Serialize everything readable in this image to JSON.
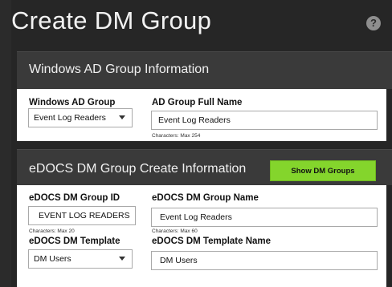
{
  "page": {
    "title": "Create DM Group",
    "help_glyph": "?"
  },
  "ad_section": {
    "heading": "Windows AD Group Information",
    "group_label": "Windows AD Group",
    "group_value": "Event Log Readers",
    "fullname_label": "AD Group Full Name",
    "fullname_value": "Event Log Readers",
    "fullname_hint": "Characters: Max 254"
  },
  "edocs_section": {
    "heading": "eDOCS DM Group Create Information",
    "show_button": "Show DM Groups",
    "id_label": "eDOCS DM Group ID",
    "id_value": "EVENT LOG READERS",
    "id_hint": "Characters: Max 20",
    "name_label": "eDOCS DM Group Name",
    "name_value": "Event Log Readers",
    "name_hint": "Characters: Max 60",
    "template_label": "eDOCS DM Template",
    "template_value": "DM Users",
    "template_name_label": "eDOCS DM Template Name",
    "template_name_value": "DM Users"
  },
  "colors": {
    "accent_green": "#84d52c",
    "background_dark": "#262626"
  }
}
